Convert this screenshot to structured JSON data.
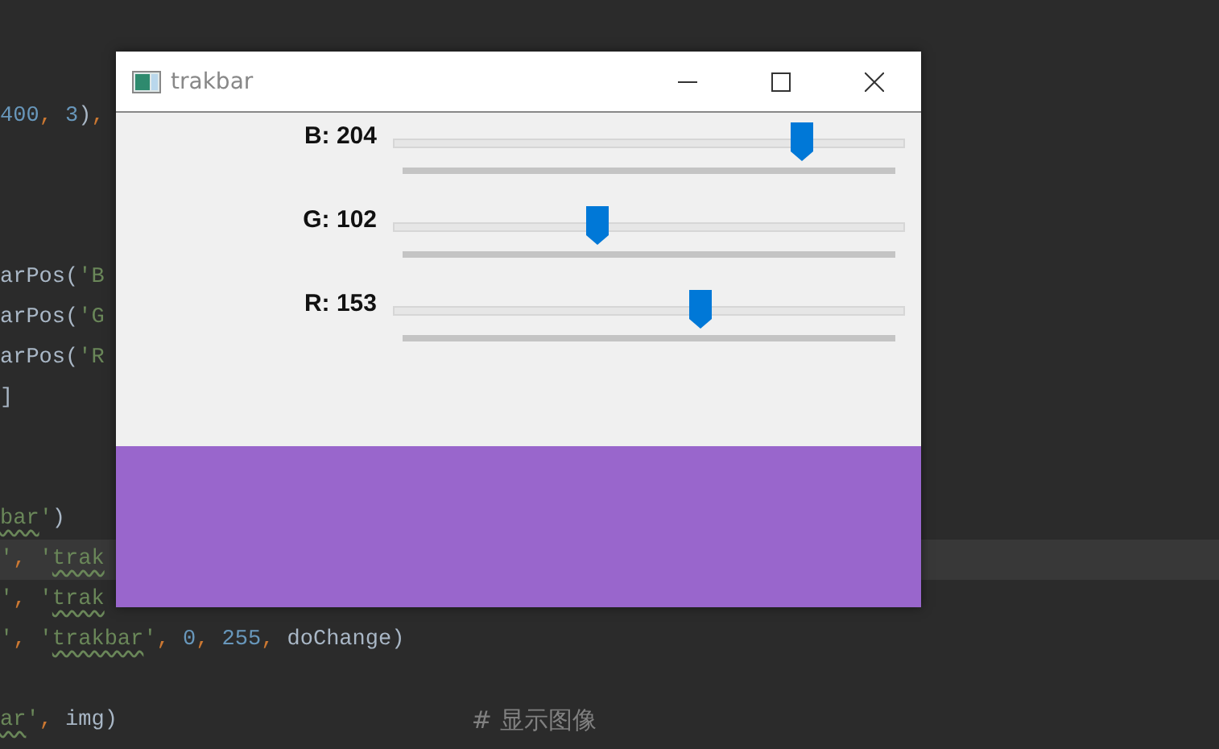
{
  "editor": {
    "lines": [
      {
        "current": false,
        "segments": [
          {
            "text": "400",
            "kind": "number"
          },
          {
            "text": ", ",
            "kind": "punct"
          },
          {
            "text": "3",
            "kind": "number"
          },
          {
            "text": ")",
            "kind": "plain"
          },
          {
            "text": ",",
            "kind": "punct"
          }
        ]
      },
      {
        "current": false
      },
      {
        "current": false
      },
      {
        "current": false
      },
      {
        "current": false,
        "segments": [
          {
            "text": "arPos(",
            "kind": "plain"
          },
          {
            "text": "'B",
            "kind": "string"
          }
        ]
      },
      {
        "current": false,
        "segments": [
          {
            "text": "arPos(",
            "kind": "plain"
          },
          {
            "text": "'G",
            "kind": "string"
          }
        ]
      },
      {
        "current": false,
        "segments": [
          {
            "text": "arPos(",
            "kind": "plain"
          },
          {
            "text": "'R",
            "kind": "string"
          }
        ]
      },
      {
        "current": false,
        "segments": [
          {
            "text": "]",
            "kind": "plain"
          }
        ]
      },
      {
        "current": false
      },
      {
        "current": false
      },
      {
        "current": false,
        "segments": [
          {
            "text": "bar",
            "kind": "typo"
          },
          {
            "text": "'",
            "kind": "string"
          },
          {
            "text": ")",
            "kind": "plain"
          }
        ]
      },
      {
        "current": true,
        "segments": [
          {
            "text": "'",
            "kind": "string"
          },
          {
            "text": ", ",
            "kind": "punct"
          },
          {
            "text": "'",
            "kind": "string"
          },
          {
            "text": "trak",
            "kind": "typo"
          }
        ]
      },
      {
        "current": false,
        "segments": [
          {
            "text": "'",
            "kind": "string"
          },
          {
            "text": ", ",
            "kind": "punct"
          },
          {
            "text": "'",
            "kind": "string"
          },
          {
            "text": "trak",
            "kind": "typo"
          }
        ]
      },
      {
        "current": false,
        "segments": [
          {
            "text": "'",
            "kind": "string"
          },
          {
            "text": ", ",
            "kind": "punct"
          },
          {
            "text": "'",
            "kind": "string"
          },
          {
            "text": "trakbar",
            "kind": "typo"
          },
          {
            "text": "'",
            "kind": "string"
          },
          {
            "text": ", ",
            "kind": "punct"
          },
          {
            "text": "0",
            "kind": "number"
          },
          {
            "text": ", ",
            "kind": "punct"
          },
          {
            "text": "255",
            "kind": "number"
          },
          {
            "text": ", ",
            "kind": "punct"
          },
          {
            "text": "doChange)",
            "kind": "plain"
          }
        ]
      },
      {
        "current": false
      },
      {
        "current": false,
        "segments": [
          {
            "text": "ar",
            "kind": "typo"
          },
          {
            "text": "'",
            "kind": "string"
          },
          {
            "text": ", ",
            "kind": "punct"
          },
          {
            "text": "img)",
            "kind": "plain"
          },
          {
            "text": "# 显示图像",
            "kind": "comment"
          }
        ]
      }
    ]
  },
  "window": {
    "title": "trakbar",
    "sliders": [
      {
        "label": "B: 204",
        "level": 0.8
      },
      {
        "label": "G: 102",
        "level": 0.4
      },
      {
        "label": "R: 153",
        "level": 0.6
      }
    ]
  }
}
